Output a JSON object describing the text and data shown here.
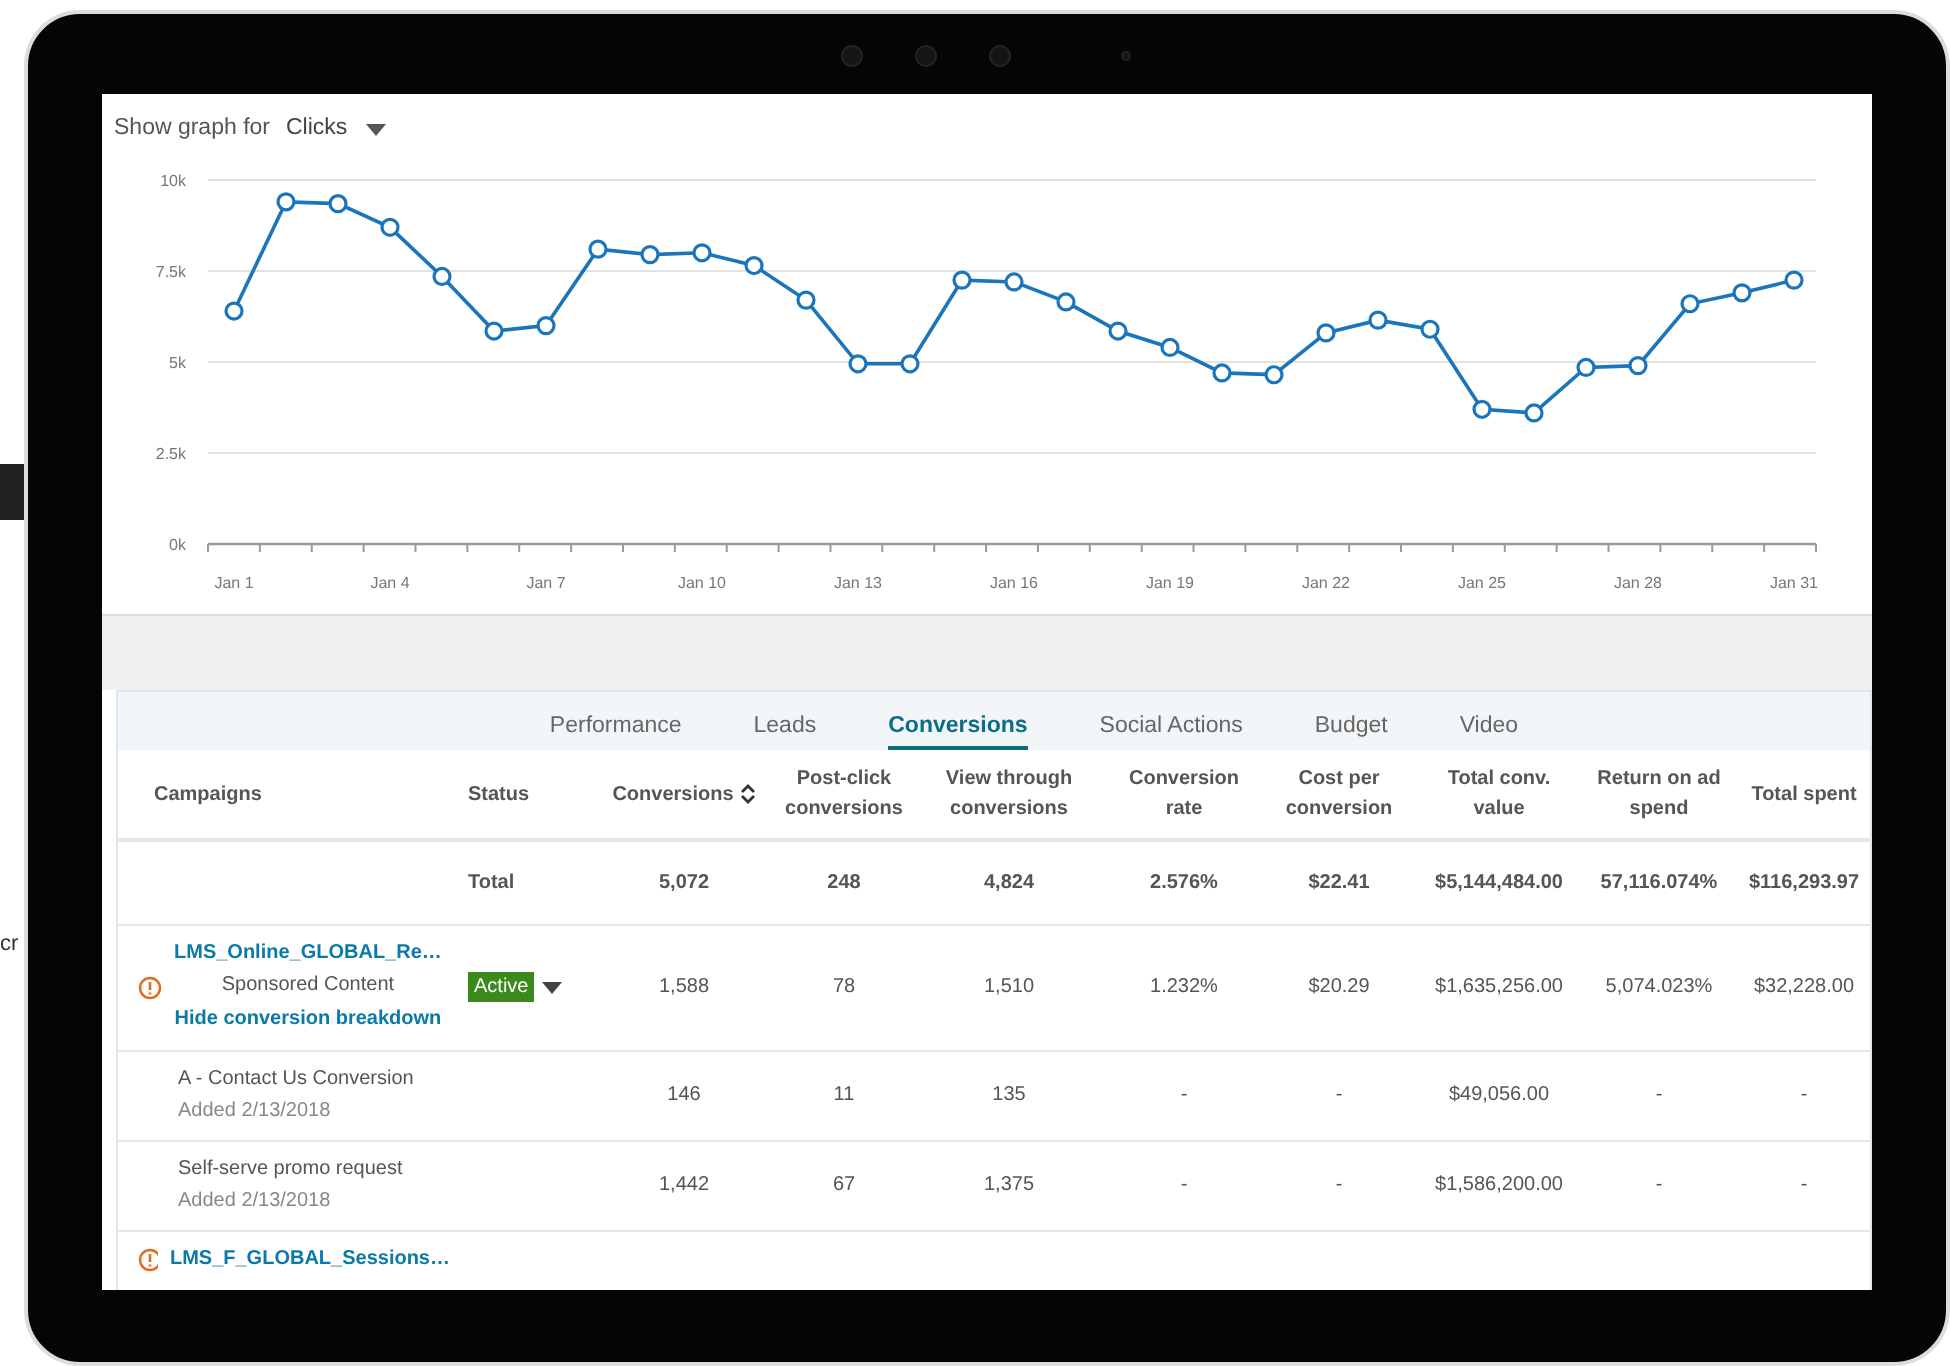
{
  "background_text": "cr",
  "graph_selector": {
    "label": "Show graph for",
    "value": "Clicks"
  },
  "chart": {
    "chart_data": {
      "type": "line",
      "categories": [
        "Jan 1",
        null,
        null,
        "Jan 4",
        null,
        null,
        "Jan 7",
        null,
        null,
        "Jan 10",
        null,
        null,
        "Jan 13",
        null,
        null,
        "Jan 16",
        null,
        null,
        "Jan 19",
        null,
        null,
        "Jan 22",
        null,
        null,
        "Jan 25",
        null,
        null,
        "Jan 28",
        null,
        null,
        "Jan 31"
      ],
      "series": [
        {
          "color": "#1b75bb",
          "marker": true,
          "values": [
            6400,
            9400,
            9350,
            8700,
            7350,
            5850,
            6000,
            8100,
            7950,
            8000,
            7650,
            6700,
            4950,
            4950,
            7250,
            7200,
            6650,
            5850,
            5400,
            4700,
            4650,
            5800,
            6150,
            5900,
            3700,
            3600,
            4850,
            4900,
            6600,
            6900,
            7250
          ]
        }
      ],
      "yticks": [
        {
          "value": 0,
          "label": "0k"
        },
        {
          "value": 2500,
          "label": "2.5k"
        },
        {
          "value": 5000,
          "label": "5k"
        },
        {
          "value": 7500,
          "label": "7.5k"
        },
        {
          "value": 10000,
          "label": "10k"
        }
      ],
      "ylim": [
        0,
        10000
      ],
      "grid": true
    }
  },
  "tabs": [
    {
      "label": "Performance",
      "selected": false
    },
    {
      "label": "Leads",
      "selected": false
    },
    {
      "label": "Conversions",
      "selected": true
    },
    {
      "label": "Social Actions",
      "selected": false
    },
    {
      "label": "Budget",
      "selected": false
    },
    {
      "label": "Video",
      "selected": false
    }
  ],
  "table": {
    "name_columns": [
      {
        "label": "Campaigns"
      },
      {
        "label": "Status"
      }
    ],
    "columns": [
      {
        "label": "Conversions",
        "sortable": true
      },
      {
        "label": "Post-click conversions",
        "sortable": false
      },
      {
        "label": "View through conversions",
        "sortable": false
      },
      {
        "label": "Conversion rate",
        "sortable": false
      },
      {
        "label": "Cost per conversion",
        "sortable": false
      },
      {
        "label": "Total conv. value",
        "sortable": false
      },
      {
        "label": "Return on ad spend",
        "sortable": false
      },
      {
        "label": "Total spent",
        "sortable": false
      }
    ],
    "total_row": {
      "label": "Total",
      "cells": [
        "5,072",
        "248",
        "4,824",
        "2.576%",
        "$22.41",
        "$5,144,484.00",
        "57,116.074%",
        "$116,293.97"
      ]
    },
    "rows": [
      {
        "kind": "campaign",
        "warning": true,
        "name": "LMS_Online_GLOBAL_Re…",
        "type": "Sponsored Content",
        "link": "Hide conversion breakdown",
        "status": "Active",
        "cells": [
          "1,588",
          "78",
          "1,510",
          "1.232%",
          "$20.29",
          "$1,635,256.00",
          "5,074.023%",
          "$32,228.00"
        ]
      },
      {
        "kind": "conversion",
        "name": "A - Contact Us Conversion",
        "added": "Added 2/13/2018",
        "cells": [
          "146",
          "11",
          "135",
          "-",
          "-",
          "$49,056.00",
          "-",
          "-"
        ]
      },
      {
        "kind": "conversion",
        "name": "Self-serve promo request",
        "added": "Added 2/13/2018",
        "cells": [
          "1,442",
          "67",
          "1,375",
          "-",
          "-",
          "$1,586,200.00",
          "-",
          "-"
        ]
      },
      {
        "kind": "campaign",
        "warning": true,
        "name": "LMS_F_GLOBAL_Sessions…"
      }
    ]
  }
}
